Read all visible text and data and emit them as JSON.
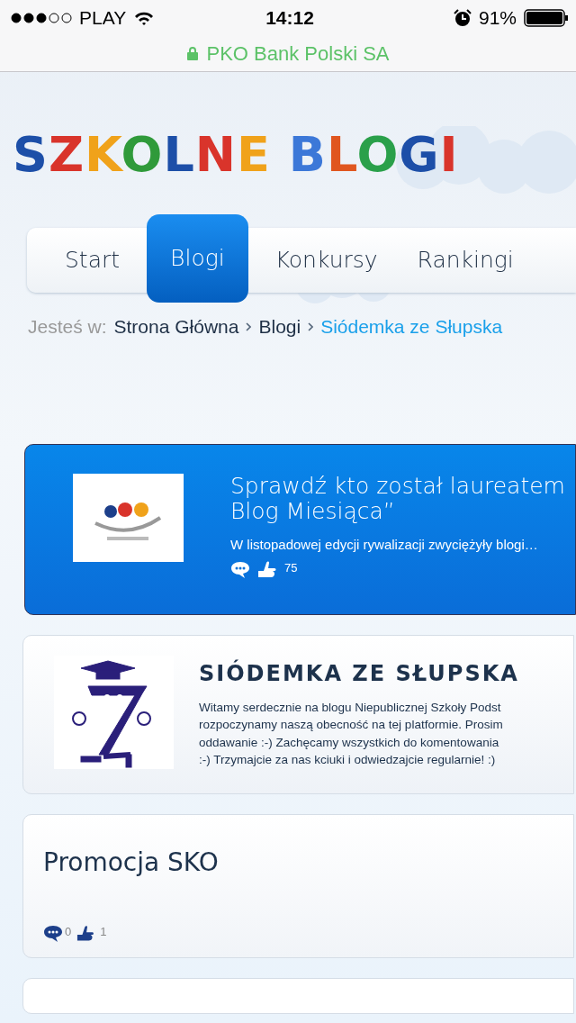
{
  "status_bar": {
    "carrier": "PLAY",
    "time": "14:12",
    "battery": "91%"
  },
  "address_bar": {
    "site": "PKO Bank Polski SA"
  },
  "logo": "SZKOLNE BLOGI",
  "tabs": [
    {
      "label": "Start",
      "selected": false
    },
    {
      "label": "Blogi",
      "selected": true
    },
    {
      "label": "Konkursy",
      "selected": false
    },
    {
      "label": "Rankingi",
      "selected": false
    }
  ],
  "breadcrumb": {
    "prefix": "Jesteś w:",
    "items": [
      {
        "label": "Strona Główna",
        "current": false
      },
      {
        "label": "Blogi",
        "current": false
      },
      {
        "label": "Siódemka ze Słupska",
        "current": true
      }
    ]
  },
  "cards": [
    {
      "kind": "featured",
      "title": "Sprawdź kto został laureatem\nBlog Miesiąca”",
      "text": "W listopadowej edycji rywalizacji zwyciężyły blogi…",
      "likes": "75"
    },
    {
      "kind": "blog",
      "title": "SIÓDEMKA ZE SŁUPSKA",
      "text": "Witamy serdecznie na blogu Niepublicznej Szkoły Podst\nrozpoczynamy naszą obecność na tej platformie. Prosim\noddawanie :-) Zachęcamy wszystkich do komentowania\n:-) Trzymajcie za nas kciuki i odwiedzajcie regularnie! :)"
    },
    {
      "kind": "post",
      "title": "Promocja SKO",
      "comments": "0",
      "likes": "1"
    }
  ]
}
